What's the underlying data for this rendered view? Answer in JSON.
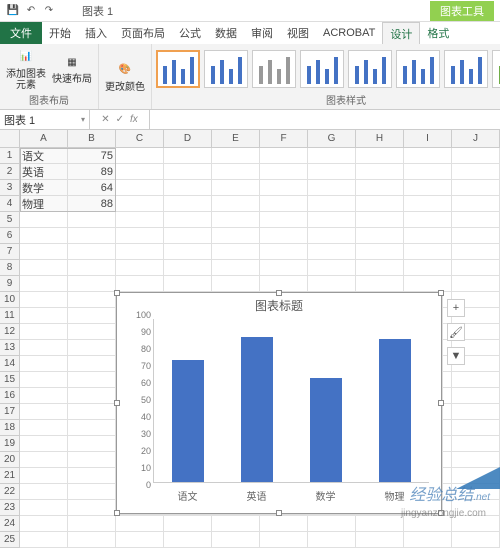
{
  "qat": {
    "save": "💾",
    "undo": "↶",
    "redo": "↷"
  },
  "title": "图表 1",
  "contextual_label": "图表工具",
  "tabs": [
    "文件",
    "开始",
    "插入",
    "页面布局",
    "公式",
    "数据",
    "审阅",
    "视图",
    "ACROBAT",
    "设计",
    "格式"
  ],
  "ribbon": {
    "layout_group": "图表布局",
    "add_chart_element": "添加图表元素",
    "quick_layout": "快速布局",
    "change_colors": "更改颜色",
    "styles_group": "图表样式"
  },
  "namebox": "图表 1",
  "fx_label": "fx",
  "columns": [
    "A",
    "B",
    "C",
    "D",
    "E",
    "F",
    "G",
    "H",
    "I",
    "J"
  ],
  "row_count": 25,
  "data_rows": [
    {
      "a": "语文",
      "b": "75"
    },
    {
      "a": "英语",
      "b": "89"
    },
    {
      "a": "数学",
      "b": "64"
    },
    {
      "a": "物理",
      "b": "88"
    }
  ],
  "chart_data": {
    "type": "bar",
    "title": "图表标题",
    "categories": [
      "语文",
      "英语",
      "数学",
      "物理"
    ],
    "values": [
      75,
      89,
      64,
      88
    ],
    "ylim": [
      0,
      100
    ],
    "yticks": [
      100,
      90,
      80,
      70,
      60,
      50,
      40,
      30,
      20,
      10,
      0
    ],
    "xlabel": "",
    "ylabel": ""
  },
  "side_icons": {
    "plus": "+",
    "brush": "🖌",
    "filter": "▼"
  },
  "watermark": "经验总结",
  "watermark_suffix": ".net",
  "watermark_sub": "jingyanzongjie.com"
}
